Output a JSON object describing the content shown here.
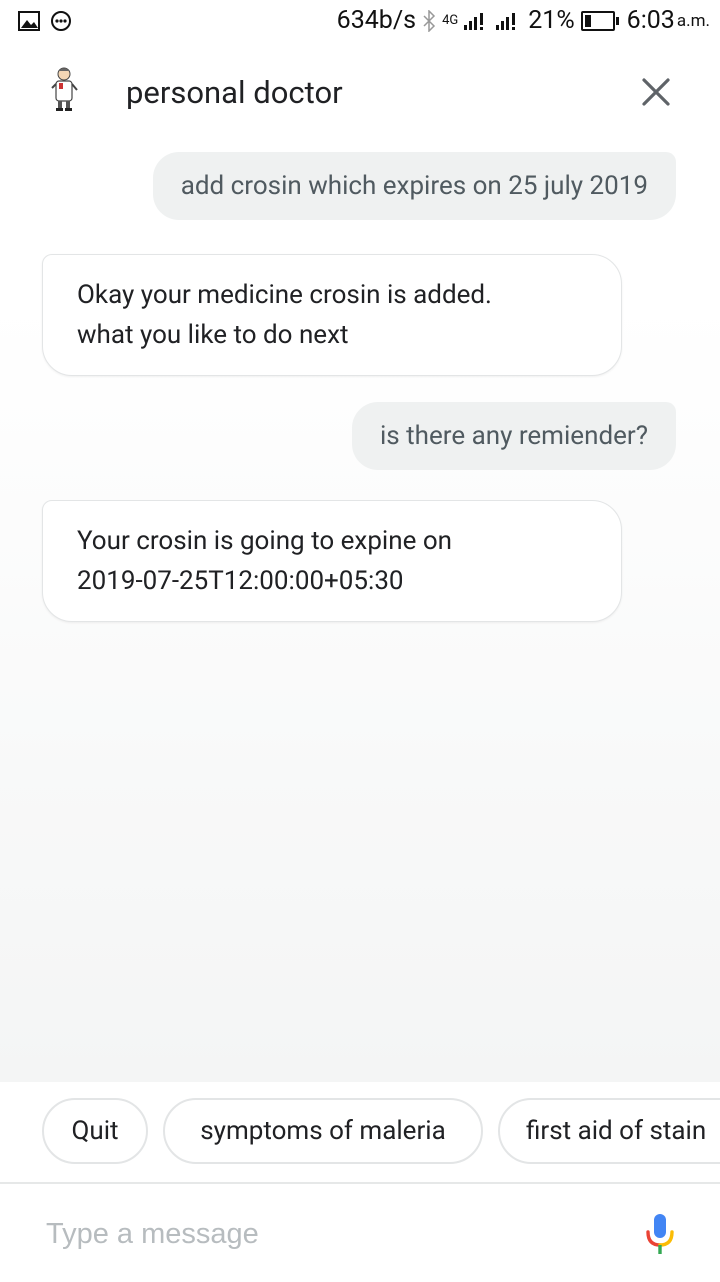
{
  "status_bar": {
    "speed": "634b/s",
    "network": "4G",
    "battery": "21%",
    "time": "6:03",
    "ampm": "a.m."
  },
  "header": {
    "title": "personal doctor"
  },
  "messages": [
    {
      "from": "user",
      "text": "add crosin which expires on 25 july 2019"
    },
    {
      "from": "bot",
      "lines": [
        "Okay your medicine crosin is added.",
        "what you like to do next"
      ]
    },
    {
      "from": "user",
      "text": "is there any remiender?"
    },
    {
      "from": "bot",
      "lines": [
        "Your crosin is going to expine on",
        "2019-07-25T12:00:00+05:30"
      ]
    }
  ],
  "suggestions": [
    "Quit",
    "symptoms of maleria",
    "first aid of stain"
  ],
  "input": {
    "placeholder": "Type a message"
  },
  "colors": {
    "user_bubble": "#eff1f1",
    "bot_border": "#e3e5e6",
    "mic_blue": "#4285F4",
    "mic_red": "#EA4335",
    "mic_yellow": "#FBBC05",
    "mic_green": "#34A853"
  }
}
